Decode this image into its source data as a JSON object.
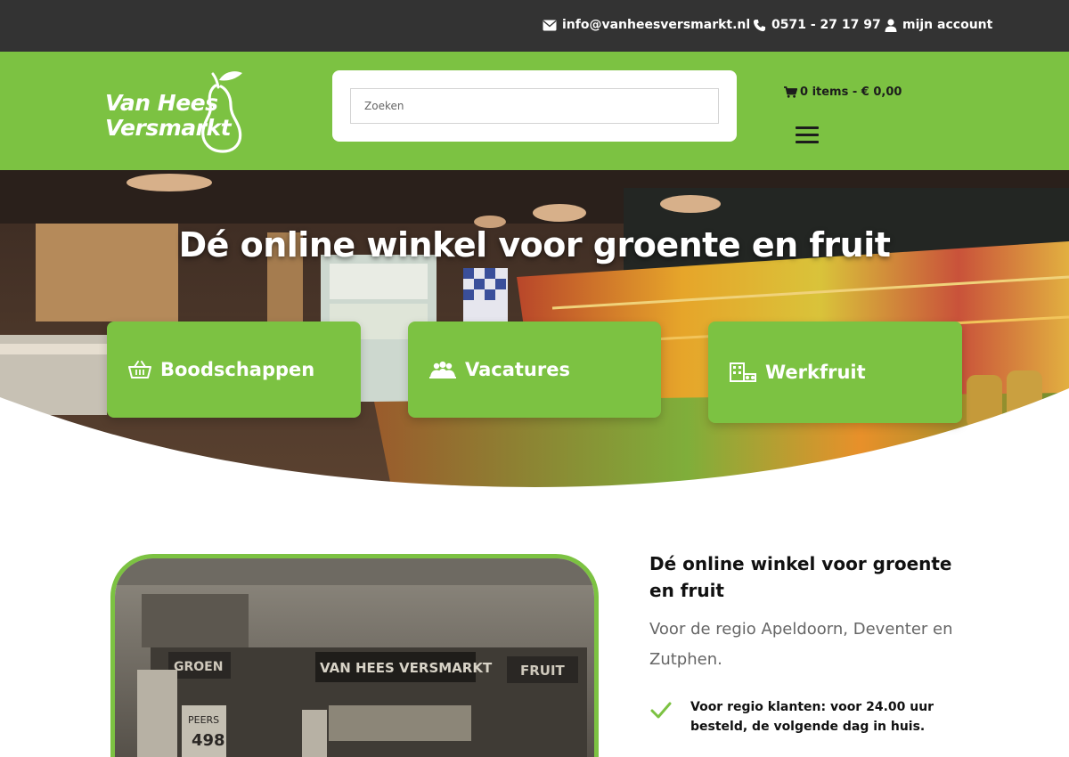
{
  "topbar": {
    "email": "info@vanheesversmarkt.nl",
    "phone": "0571 - 27 17 97",
    "account": "mijn account"
  },
  "header": {
    "logo_line1": "Van Hees",
    "logo_line2": "Versmarkt",
    "search_placeholder": "Zoeken",
    "cart_text": "0 items - € 0,00"
  },
  "hero": {
    "title": "Dé online winkel voor groente en fruit",
    "cards": [
      {
        "label": "Boodschappen",
        "icon": "basket-icon"
      },
      {
        "label": "Vacatures",
        "icon": "people-icon"
      },
      {
        "label": "Werkfruit",
        "icon": "office-icon"
      }
    ]
  },
  "intro": {
    "title": "Dé online winkel voor groente en fruit",
    "subtitle": "Voor de regio Apeldoorn, Deventer en Zutphen.",
    "features": [
      {
        "text": "Voor regio klanten: voor 24.00 uur besteld, de volgende dag in huis."
      }
    ]
  },
  "colors": {
    "brand_green": "#7cc242",
    "topbar": "#333333",
    "text_dark": "#111111",
    "text_muted": "#666666"
  }
}
